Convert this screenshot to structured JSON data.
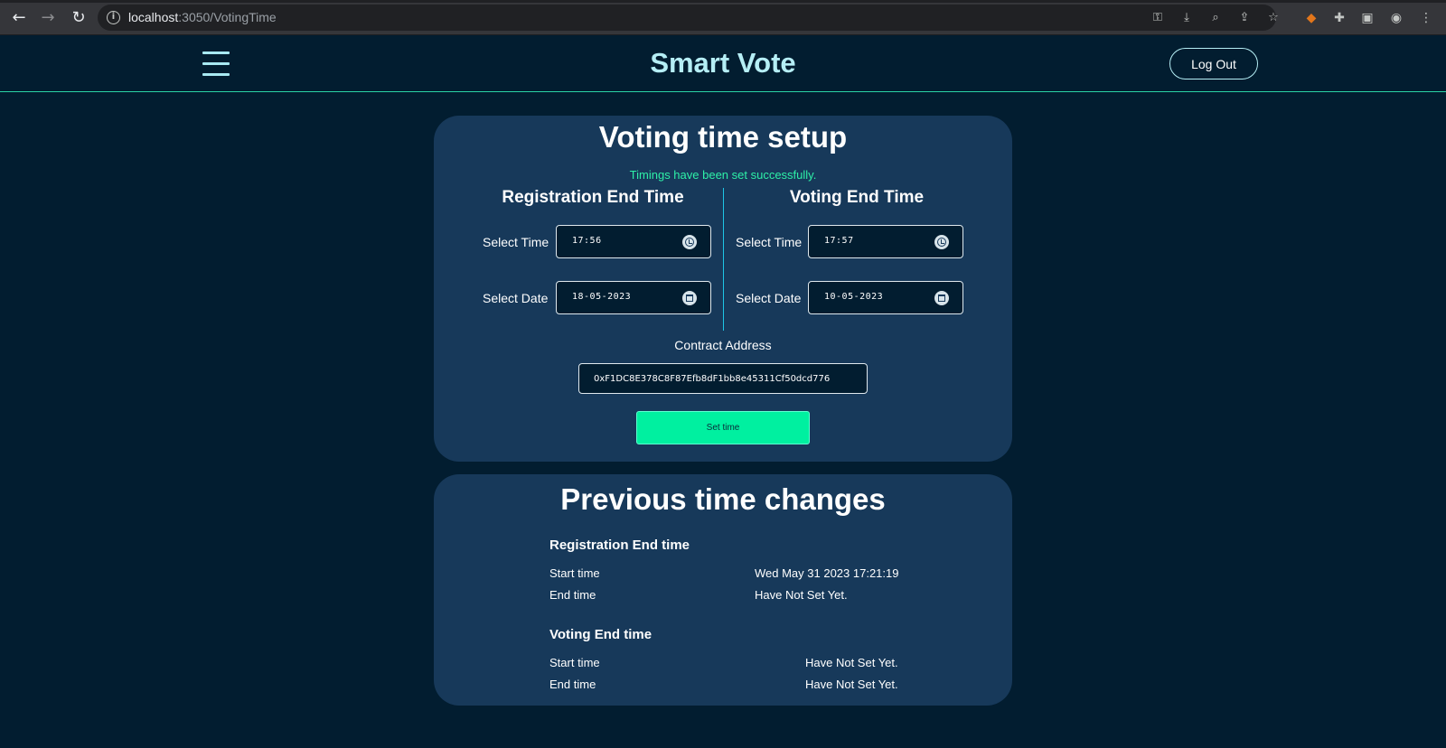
{
  "browser": {
    "url_host": "localhost",
    "url_path": ":3050/VotingTime"
  },
  "header": {
    "brand": "Smart Vote",
    "logout_label": "Log Out"
  },
  "setup": {
    "title": "Voting time setup",
    "success_message": "Timings have been set successfully.",
    "registration": {
      "title": "Registration End Time",
      "time_label": "Select Time",
      "time_value": "17:56",
      "date_label": "Select Date",
      "date_value": "18-05-2023"
    },
    "voting": {
      "title": "Voting End Time",
      "time_label": "Select Time",
      "time_value": "17:57",
      "date_label": "Select Date",
      "date_value": "10-05-2023"
    },
    "contract_label": "Contract Address",
    "contract_value": "0xF1DC8E378C8F87Efb8dF1bb8e45311Cf50dcd776",
    "set_button": "Set time"
  },
  "history": {
    "title": "Previous time changes",
    "registration": {
      "title": "Registration End time",
      "start_label": "Start time",
      "start_value": "Wed May 31 2023 17:21:19",
      "end_label": "End time",
      "end_value": "Have Not Set Yet."
    },
    "voting": {
      "title": "Voting End time",
      "start_label": "Start time",
      "start_value": "Have Not Set Yet.",
      "end_label": "End time",
      "end_value": "Have Not Set Yet."
    }
  }
}
